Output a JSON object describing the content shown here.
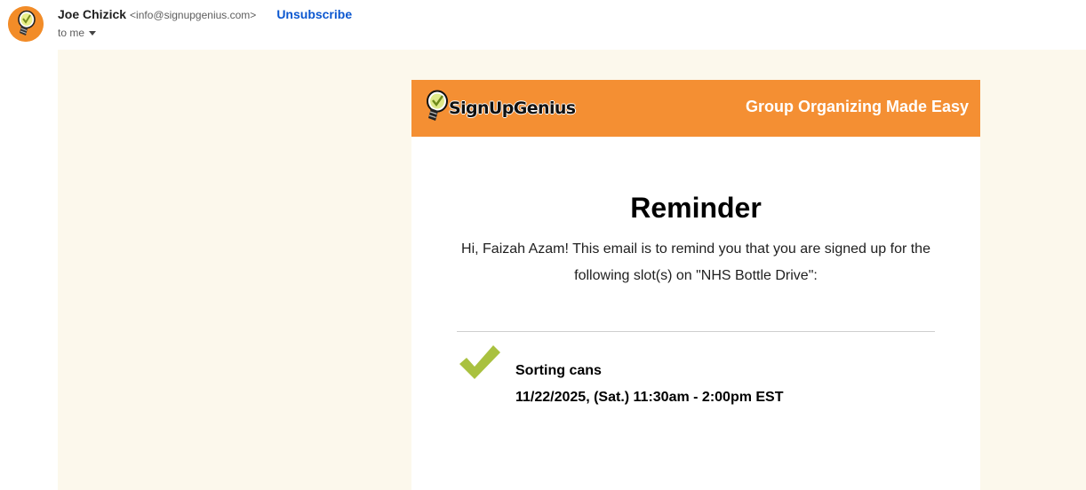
{
  "header": {
    "sender_name": "Joe Chizick",
    "sender_email": "<info@signupgenius.com>",
    "unsubscribe_label": "Unsubscribe",
    "recipient_label": "to me",
    "avatar_icon": "signupgenius-lightbulb-icon",
    "avatar_color": "#f28c28"
  },
  "email": {
    "background_color": "#fcf8ec",
    "banner": {
      "logo_text": "SignUpGenius",
      "tagline": "Group Organizing Made Easy",
      "color": "#f48f33"
    },
    "heading": "Reminder",
    "intro": "Hi, Faizah Azam! This email is to remind you that you are signed up for the following slot(s) on \"NHS Bottle Drive\":",
    "slot": {
      "icon": "checkmark-icon",
      "icon_color": "#a9c13f",
      "title": "Sorting cans",
      "datetime": "11/22/2025, (Sat.) 11:30am - 2:00pm EST"
    }
  }
}
